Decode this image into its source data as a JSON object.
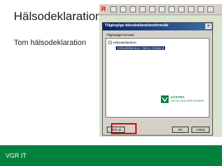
{
  "slide": {
    "title": "Hälsodeklaration",
    "bullet": "Tom hälsodeklaration",
    "footer": "VGR IT"
  },
  "app": {
    "toolbar_first_glyph": "R",
    "dialog": {
      "title": "Tillgängliga hälsodeklarationsformulär",
      "close_glyph": "×",
      "group_label": "Tillgängliga formulär",
      "tree": {
        "expander": "−",
        "root": "Hälsodeklaration",
        "child": "Hälsodeklaration Västra Götaland"
      },
      "buttons": {
        "print": "Skriv ut",
        "ok": "OK",
        "cancel": "Avbryt"
      }
    }
  },
  "logo": {
    "line1": "VÄSTRA",
    "line2": "GÖTALANDSREGIONEN"
  },
  "colors": {
    "brand_green": "#00813d",
    "highlight_red": "#e00000",
    "titlebar_blue": "#0a246a"
  }
}
